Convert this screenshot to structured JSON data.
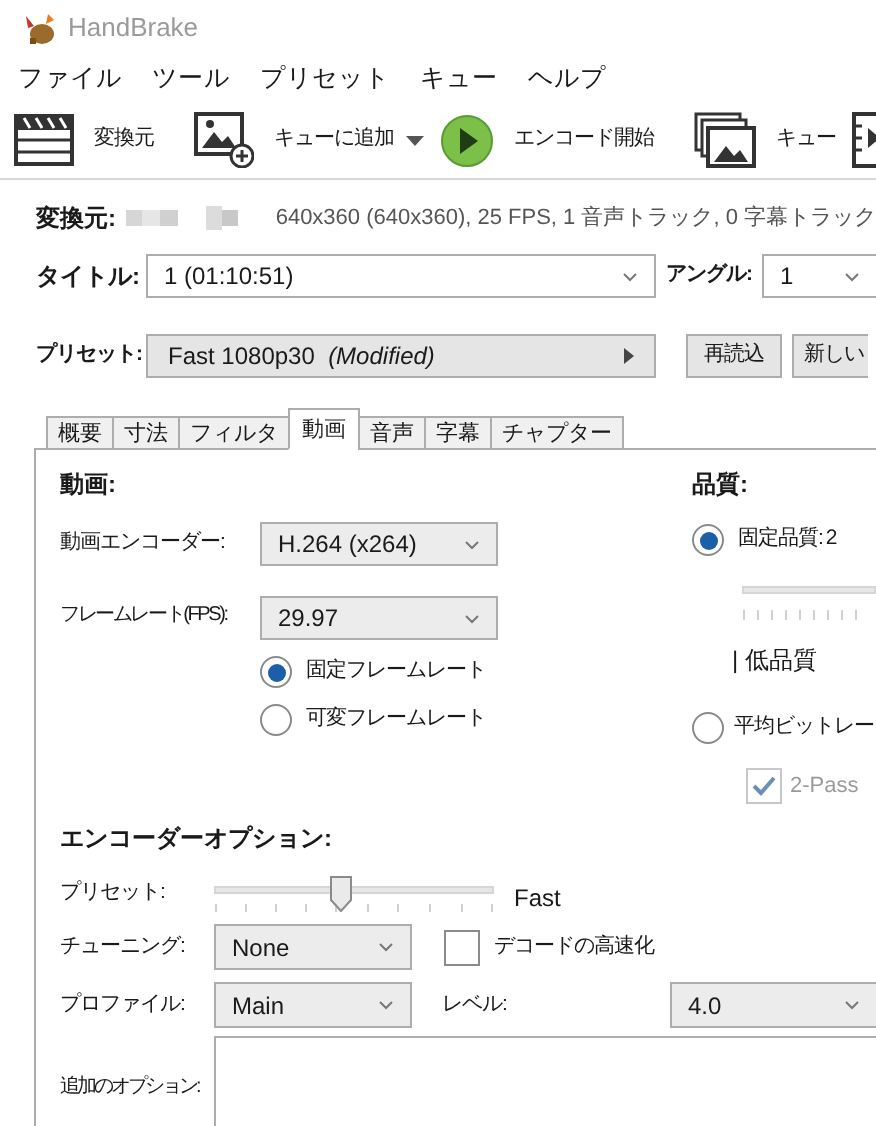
{
  "window": {
    "title": "HandBrake"
  },
  "menu": [
    "ファイル",
    "ツール",
    "プリセット",
    "キュー",
    "ヘルプ"
  ],
  "toolbar": [
    {
      "kind": "source",
      "label": "変換元"
    },
    {
      "kind": "add_queue",
      "label": "キューに追加",
      "dropdown": true
    },
    {
      "kind": "start",
      "label": "エンコード開始"
    },
    {
      "kind": "queue",
      "label": "キュー"
    },
    {
      "kind": "preview"
    }
  ],
  "source": {
    "label": "変換元:",
    "info": "640x360 (640x360), 25 FPS, 1 音声トラック, 0 字幕トラック"
  },
  "title_select": {
    "label": "タイトル:",
    "value": "1  (01:10:51)"
  },
  "angle_select": {
    "label": "アングル:",
    "value": "1"
  },
  "preset": {
    "label": "プリセット:",
    "value": "Fast 1080p30  *(Modified)*"
  },
  "preset_buttons": [
    "再読込",
    "新しい"
  ],
  "tabs": [
    {
      "label": "概要",
      "selected": false
    },
    {
      "label": "寸法",
      "selected": false
    },
    {
      "label": "フィルタ",
      "selected": false
    },
    {
      "label": "動画",
      "selected": true
    },
    {
      "label": "音声",
      "selected": false
    },
    {
      "label": "字幕",
      "selected": false
    },
    {
      "label": "チャプター",
      "selected": false
    }
  ],
  "video": {
    "heading": "動画:",
    "encoder": {
      "label": "動画エンコーダー:",
      "value": "H.264 (x264)"
    },
    "framerate": {
      "label": "フレームレート(FPS):",
      "value": "29.97"
    },
    "framerate_modes": [
      {
        "label": "固定フレームレート",
        "selected": true
      },
      {
        "label": "可変フレームレート",
        "selected": false
      }
    ]
  },
  "quality": {
    "heading": "品質:",
    "modes": [
      {
        "label": "固定品質: 2",
        "selected": true
      },
      {
        "label": "平均ビットレー",
        "selected": false
      }
    ],
    "slider_caption": "| 低品質",
    "two_pass": {
      "label": "2-Pass",
      "checked": true,
      "disabled": true
    }
  },
  "encoder_options": {
    "heading": "エンコーダーオプション:",
    "preset": {
      "label": "プリセット:",
      "level": 0.45,
      "value": "Fast"
    },
    "tune": {
      "label": "チューニング:",
      "value": "None"
    },
    "fast_decode": {
      "label": "デコードの高速化",
      "checked": false
    },
    "profile": {
      "label": "プロファイル:",
      "value": "Main"
    },
    "level": {
      "label": "レベル:",
      "value": "4.0"
    },
    "extra": {
      "label": "追加のオプション:"
    }
  }
}
